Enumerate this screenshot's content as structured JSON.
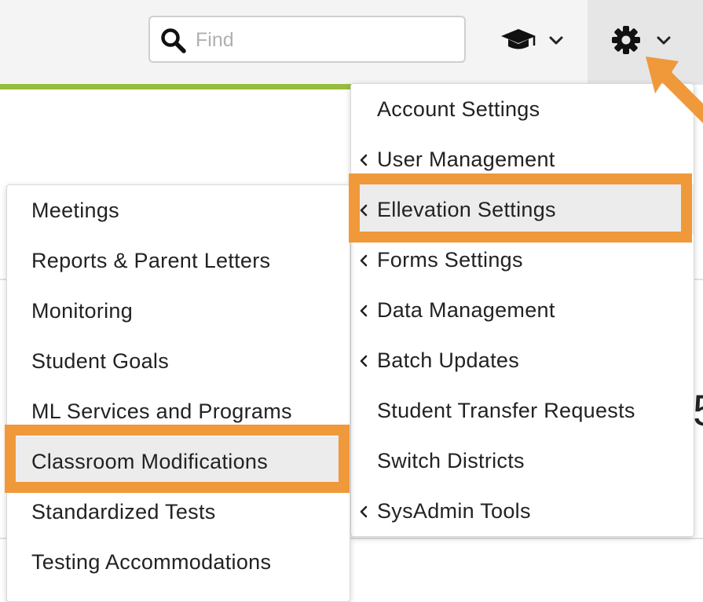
{
  "header": {
    "search": {
      "placeholder": "Find",
      "value": ""
    }
  },
  "settings_menu": {
    "items": [
      {
        "label": "Account Settings",
        "submenu": false
      },
      {
        "label": "User Management",
        "submenu": true
      },
      {
        "label": "Ellevation Settings",
        "submenu": true,
        "highlighted": true
      },
      {
        "label": "Forms Settings",
        "submenu": true
      },
      {
        "label": "Data Management",
        "submenu": true
      },
      {
        "label": "Batch Updates",
        "submenu": true
      },
      {
        "label": "Student Transfer Requests",
        "submenu": false
      },
      {
        "label": "Switch Districts",
        "submenu": false
      },
      {
        "label": "SysAdmin Tools",
        "submenu": true
      }
    ]
  },
  "ellevation_submenu": {
    "items": [
      {
        "label": "Meetings"
      },
      {
        "label": "Reports & Parent Letters"
      },
      {
        "label": "Monitoring"
      },
      {
        "label": "Student Goals"
      },
      {
        "label": "ML Services and Programs"
      },
      {
        "label": "Classroom Modifications",
        "highlighted": true
      },
      {
        "label": "Standardized Tests"
      },
      {
        "label": "Testing Accommodations"
      }
    ]
  },
  "background": {
    "partial_glyph": "5"
  },
  "colors": {
    "accent_orange": "#f0993a",
    "accent_green": "#97bd3c",
    "topbar_bg": "#f4f4f4",
    "highlight_bg": "#ececec"
  },
  "icons": {
    "search": "search-icon",
    "cap": "graduation-cap-icon",
    "gear": "gear-icon",
    "chevron_down": "chevron-down-icon",
    "chevron_left": "chevron-left-icon"
  }
}
